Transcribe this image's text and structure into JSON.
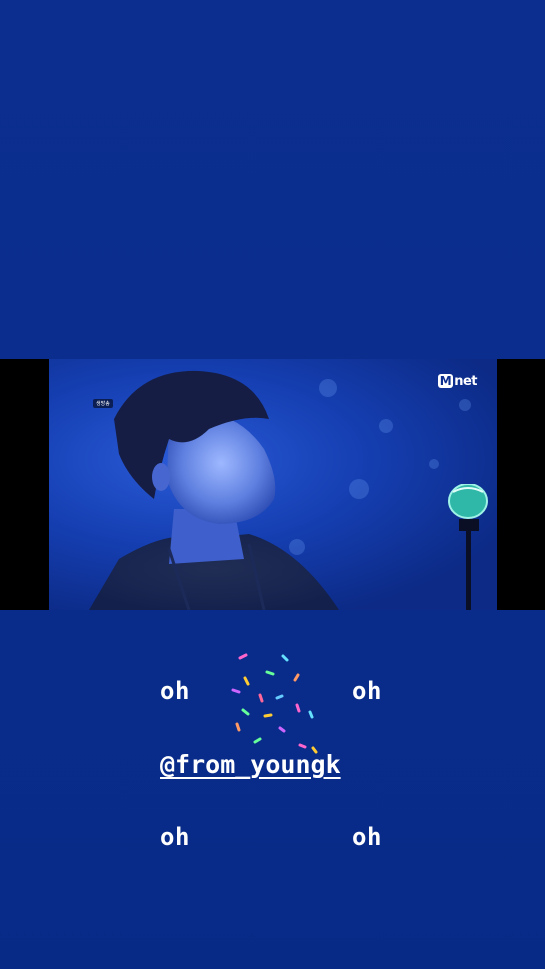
{
  "story": {
    "background_color": "#0b2e8f",
    "video": {
      "broadcast_badge": "생방송",
      "logo": {
        "m": "M",
        "rest": "net"
      }
    },
    "captions": {
      "oh_1": "oh",
      "oh_2": "oh",
      "oh_3": "oh",
      "oh_4": "oh"
    },
    "mention": "@from_youngk",
    "sticker": "confetti-sticker"
  }
}
